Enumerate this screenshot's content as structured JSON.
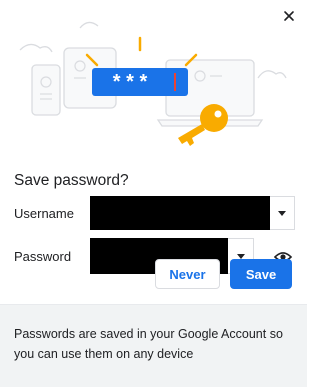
{
  "dialog": {
    "close_icon": "close-icon",
    "title": "Save password?",
    "username_label": "Username",
    "password_label": "Password",
    "password_masked": "* * *",
    "eye_icon": "eye-icon",
    "never_label": "Never",
    "save_label": "Save",
    "footer_text": "Passwords are saved in your Google Account so you can use them on any device"
  },
  "colors": {
    "accent": "#1a73e8",
    "key": "#f9ab00",
    "footer_bg": "#f1f3f4"
  }
}
